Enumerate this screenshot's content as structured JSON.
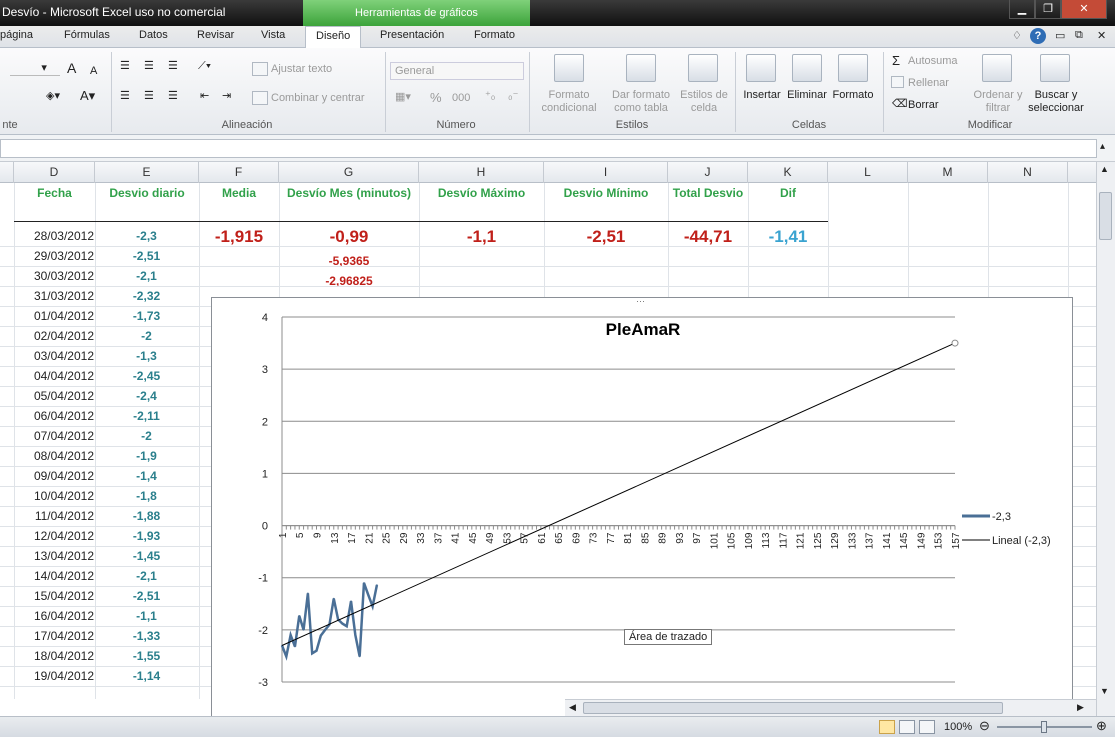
{
  "window": {
    "title": "Desvío - Microsoft Excel uso no comercial",
    "context_group": "Herramientas de gráficos"
  },
  "tabs": [
    "página",
    "Fórmulas",
    "Datos",
    "Revisar",
    "Vista",
    "Diseño",
    "Presentación",
    "Formato"
  ],
  "ribbon": {
    "font_size_a": "A",
    "font_size_b": "A",
    "wrap_text": "Ajustar texto",
    "merge_center": "Combinar y centrar",
    "number_format": "General",
    "percent": "%",
    "thousands": "000",
    "cond_format": "Formato condicional",
    "format_table": "Dar formato como tabla",
    "cell_styles": "Estilos de celda",
    "insert": "Insertar",
    "delete": "Eliminar",
    "format": "Formato",
    "autosum": "Autosuma",
    "fill": "Rellenar",
    "clear": "Borrar",
    "sort_filter": "Ordenar y filtrar",
    "find_select": "Buscar y seleccionar",
    "groups": {
      "font": "nte",
      "alignment": "Alineación",
      "number": "Número",
      "styles": "Estilos",
      "cells": "Celdas",
      "editing": "Modificar"
    }
  },
  "columns": [
    "D",
    "E",
    "F",
    "G",
    "H",
    "I",
    "J",
    "K",
    "L",
    "M",
    "N"
  ],
  "headers": {
    "fecha": "Fecha",
    "desvio_diario": "Desvio diario",
    "media": "Media",
    "desvio_mes": "Desvío Mes (minutos)",
    "desvio_max": "Desvío Máximo",
    "desvio_min": "Desvio Mínimo",
    "total": "Total Desvio",
    "dif": "Dif"
  },
  "summary": {
    "media": "-1,915",
    "desvio_mes": "-0,99",
    "desvio_max": "-1,1",
    "desvio_min": "-2,51",
    "total": "-44,71",
    "dif": "-1,41",
    "g2": "-5,9365",
    "g3": "-2,96825"
  },
  "rows": [
    {
      "fecha": "28/03/2012",
      "val": "-2,3"
    },
    {
      "fecha": "29/03/2012",
      "val": "-2,51"
    },
    {
      "fecha": "30/03/2012",
      "val": "-2,1"
    },
    {
      "fecha": "31/03/2012",
      "val": "-2,32"
    },
    {
      "fecha": "01/04/2012",
      "val": "-1,73"
    },
    {
      "fecha": "02/04/2012",
      "val": "-2"
    },
    {
      "fecha": "03/04/2012",
      "val": "-1,3"
    },
    {
      "fecha": "04/04/2012",
      "val": "-2,45"
    },
    {
      "fecha": "05/04/2012",
      "val": "-2,4"
    },
    {
      "fecha": "06/04/2012",
      "val": "-2,11"
    },
    {
      "fecha": "07/04/2012",
      "val": "-2"
    },
    {
      "fecha": "08/04/2012",
      "val": "-1,9"
    },
    {
      "fecha": "09/04/2012",
      "val": "-1,4"
    },
    {
      "fecha": "10/04/2012",
      "val": "-1,8"
    },
    {
      "fecha": "11/04/2012",
      "val": "-1,88"
    },
    {
      "fecha": "12/04/2012",
      "val": "-1,93"
    },
    {
      "fecha": "13/04/2012",
      "val": "-1,45"
    },
    {
      "fecha": "14/04/2012",
      "val": "-2,1"
    },
    {
      "fecha": "15/04/2012",
      "val": "-2,51"
    },
    {
      "fecha": "16/04/2012",
      "val": "-1,1"
    },
    {
      "fecha": "17/04/2012",
      "val": "-1,33"
    },
    {
      "fecha": "18/04/2012",
      "val": "-1,55"
    },
    {
      "fecha": "19/04/2012",
      "val": "-1,14"
    }
  ],
  "tooltip": "Área de trazado",
  "status": {
    "zoom": "100%"
  },
  "colors": {
    "series": "#4a6f96",
    "trend": "#000000",
    "dark_red": "#c0201a",
    "teal": "#2a7f8c",
    "green": "#31a14a",
    "dif": "#3aa3d0"
  },
  "chart_data": {
    "type": "line",
    "title": "PleAmaR",
    "ylim": [
      -3,
      4
    ],
    "yticks": [
      -3,
      -2,
      -1,
      0,
      1,
      2,
      3,
      4
    ],
    "xticks": [
      "1",
      "5",
      "9",
      "13",
      "17",
      "21",
      "25",
      "29",
      "33",
      "37",
      "41",
      "45",
      "49",
      "53",
      "57",
      "61",
      "65",
      "69",
      "73",
      "77",
      "81",
      "85",
      "89",
      "93",
      "97",
      "101",
      "105",
      "109",
      "113",
      "117",
      "121",
      "125",
      "129",
      "133",
      "137",
      "141",
      "145",
      "149",
      "153",
      "157"
    ],
    "grid": true,
    "legend_position": "right",
    "series": [
      {
        "name": "-2,3",
        "x": [
          1,
          2,
          3,
          4,
          5,
          6,
          7,
          8,
          9,
          10,
          11,
          12,
          13,
          14,
          15,
          16,
          17,
          18,
          19,
          20,
          21,
          22,
          23
        ],
        "values": [
          -2.3,
          -2.51,
          -2.1,
          -2.32,
          -1.73,
          -2,
          -1.3,
          -2.45,
          -2.4,
          -2.11,
          -2,
          -1.9,
          -1.4,
          -1.8,
          -1.88,
          -1.93,
          -1.45,
          -2.1,
          -2.51,
          -1.1,
          -1.33,
          -1.55,
          -1.14
        ]
      },
      {
        "name": "Lineal (-2,3)",
        "x": [
          1,
          157
        ],
        "values": [
          -2.3,
          3.5
        ]
      }
    ]
  }
}
